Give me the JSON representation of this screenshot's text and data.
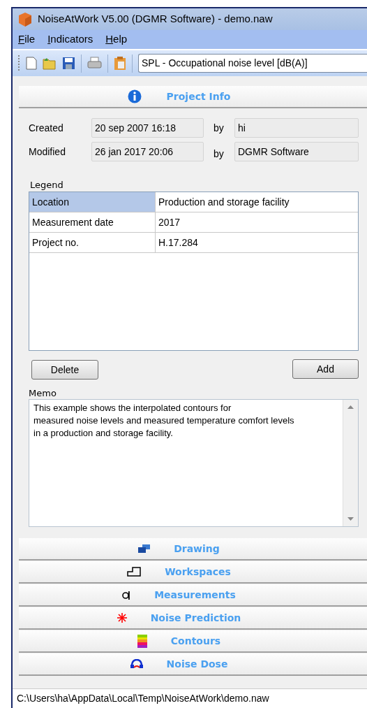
{
  "window": {
    "title": "NoiseAtWork V5.00 (DGMR Software) - demo.naw"
  },
  "menu": [
    "File",
    "Indicators",
    "Help"
  ],
  "toolbar": {
    "indicator": "SPL - Occupational noise level [dB(A)]"
  },
  "project_info": {
    "title": "Project Info",
    "expanded": true,
    "created": {
      "label": "Created",
      "date": "20 sep 2007 16:18",
      "by_label": "by",
      "by": "hi"
    },
    "modified": {
      "label": "Modified",
      "date": "26 jan 2017 20:06",
      "by_label": "by",
      "by": "DGMR Software"
    },
    "legend": {
      "label": "Legend",
      "rows": [
        {
          "key": "Location",
          "value": "Production and storage facility",
          "selected": true
        },
        {
          "key": "Measurement date",
          "value": "2017",
          "selected": false
        },
        {
          "key": "Project no.",
          "value": "H.17.284",
          "selected": false
        }
      ]
    },
    "buttons": [
      "Delete",
      "Add"
    ],
    "memo": {
      "label": "Memo",
      "value": "This example shows the interpolated contours for\nmeasured noise levels and measured temperature comfort levels\nin a production and storage facility."
    }
  },
  "sections": [
    {
      "title": "Drawing",
      "kind": "drawing",
      "expanded": false
    },
    {
      "title": "Workspaces",
      "kind": "workspaces",
      "expanded": false
    },
    {
      "title": "Measurements",
      "kind": "measurements",
      "expanded": false
    },
    {
      "title": "Noise Prediction",
      "kind": "prediction",
      "expanded": false
    },
    {
      "title": "Contours",
      "kind": "contours",
      "expanded": false
    },
    {
      "title": "Noise Dose",
      "kind": "dose",
      "expanded": false
    }
  ],
  "status_bar": "C:\\Users\\ha\\AppData\\Local\\Temp\\NoiseAtWork\\demo.naw"
}
